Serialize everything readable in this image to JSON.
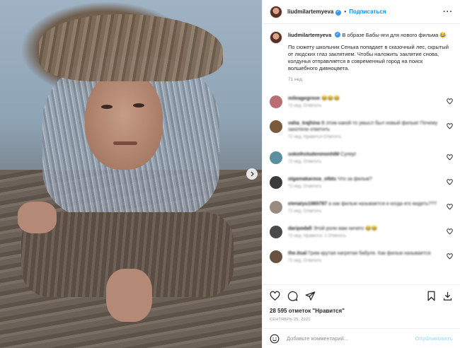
{
  "post": {
    "username": "liudmilartemyeva",
    "follow_label": "Подписаться",
    "caption_headline": "В образе Бабы-яги для нового фильма 😂",
    "caption_body": "По сюжету школьник Сенька попадает в сказочный лес, скрытый от людских глаз заклятием. Чтобы наложить заклятие снова, колдунья отправляется в современный город на поиск волшебного дивноцвета.",
    "age": "71 нед.",
    "likes": "28 595 отметок \"Нравится\"",
    "date": "СЕНТЯБРЬ 25, 2021",
    "comment_placeholder": "Добавьте комментарий...",
    "publish_label": "Опубликовать"
  },
  "comments": [
    {
      "user": "mileagegrove",
      "text": "😂😂😂",
      "meta": "72 нед.   Ответить",
      "avatar_color": "#b86e73"
    },
    {
      "user": "vaha_trajhina",
      "text": "В этом какой-то умысл был новый фильм! Почему захотели ответить",
      "meta": "72 нед.   Нравится   Ответить",
      "avatar_color": "#7a5a3a"
    },
    {
      "user": "sokolhstudenmonhIM",
      "text": "Супер!",
      "meta": "72 нед.   Ответить",
      "avatar_color": "#5b8fa0"
    },
    {
      "user": "olgamakarova_ofbts",
      "text": "Что за фильм?",
      "meta": "72 нед.   Ответить",
      "avatar_color": "#3b3b3b"
    },
    {
      "user": "elenalyu1980787",
      "text": "а как фильм называется и когда его видеть???",
      "meta": "72 нед.   Ответить",
      "avatar_color": "#9a8a80"
    },
    {
      "user": "daripodafi",
      "text": "Этой роли вам ничего 😂😂",
      "meta": "72 нед.   Нравится: 1   Ответить",
      "avatar_color": "#4a4a4a"
    },
    {
      "user": "the.itsal",
      "text": "Грим крутая нагретая бабуля. Как фильм называется",
      "meta": "72 нед.   Ответить",
      "avatar_color": "#6a5240"
    }
  ],
  "colors": {
    "accent": "#0095f6",
    "verified": "#3897f0",
    "muted": "#8e8e8e"
  },
  "icons": [
    "heart-icon",
    "comment-icon",
    "share-icon",
    "bookmark-icon",
    "download-icon",
    "emoji-icon",
    "more-icon",
    "chevron-right-icon"
  ]
}
